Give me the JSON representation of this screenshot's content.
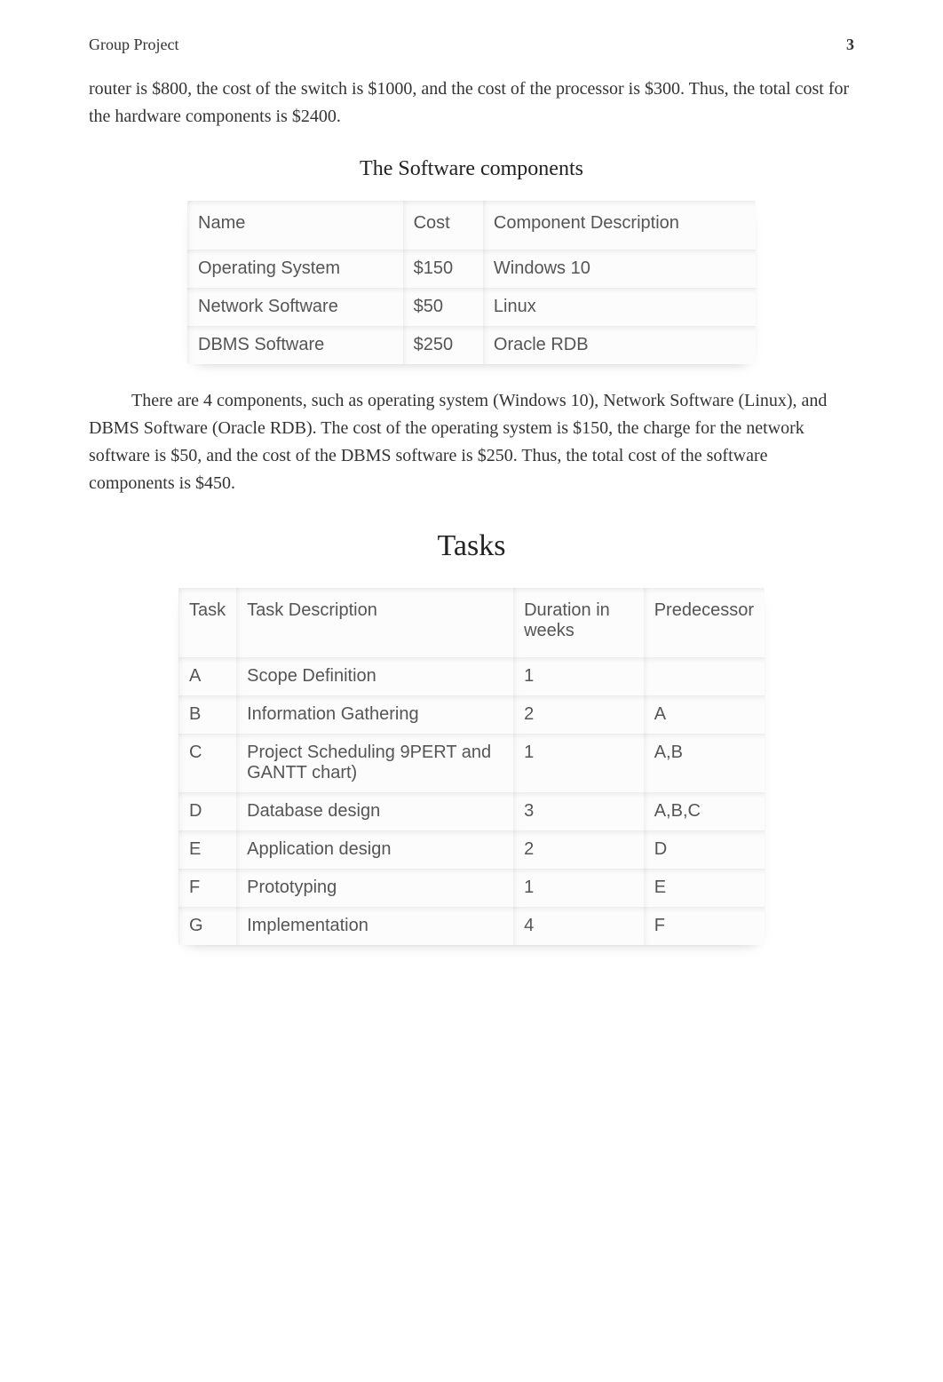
{
  "header": {
    "title": "Group Project",
    "page_number": "3"
  },
  "para1": "router is $800, the cost of the switch is $1000, and the cost of the processor is $300. Thus, the total cost for the hardware components is $2400.",
  "software": {
    "title": "The Software components",
    "columns": [
      "Name",
      "Cost",
      "Component Description"
    ],
    "rows": [
      {
        "name": "Operating System",
        "cost": "$150",
        "desc": "Windows 10"
      },
      {
        "name": "Network Software",
        "cost": "$50",
        "desc": "Linux"
      },
      {
        "name": "DBMS Software",
        "cost": "$250",
        "desc": "Oracle RDB"
      }
    ]
  },
  "para2": "There are 4 components, such as operating system (Windows 10), Network Software (Linux), and DBMS Software (Oracle RDB). The cost of the operating system is $150, the charge for the network software is $50, and the cost of the DBMS software is $250. Thus, the total cost of the software components is $450.",
  "tasks": {
    "title": "Tasks",
    "columns": [
      "Task",
      "Task Description",
      "Duration in weeks",
      "Predecessor"
    ],
    "rows": [
      {
        "task": "A",
        "desc": "Scope Definition",
        "dur": "1",
        "pred": ""
      },
      {
        "task": "B",
        "desc": "Information Gathering",
        "dur": "2",
        "pred": "A"
      },
      {
        "task": "C",
        "desc": "Project Scheduling 9PERT and GANTT chart)",
        "dur": "1",
        "pred": "A,B"
      },
      {
        "task": "D",
        "desc": "Database design",
        "dur": "3",
        "pred": "A,B,C"
      },
      {
        "task": "E",
        "desc": "Application design",
        "dur": "2",
        "pred": "D"
      },
      {
        "task": "F",
        "desc": "Prototyping",
        "dur": "1",
        "pred": "E"
      },
      {
        "task": "G",
        "desc": "Implementation",
        "dur": "4",
        "pred": "F"
      }
    ]
  }
}
